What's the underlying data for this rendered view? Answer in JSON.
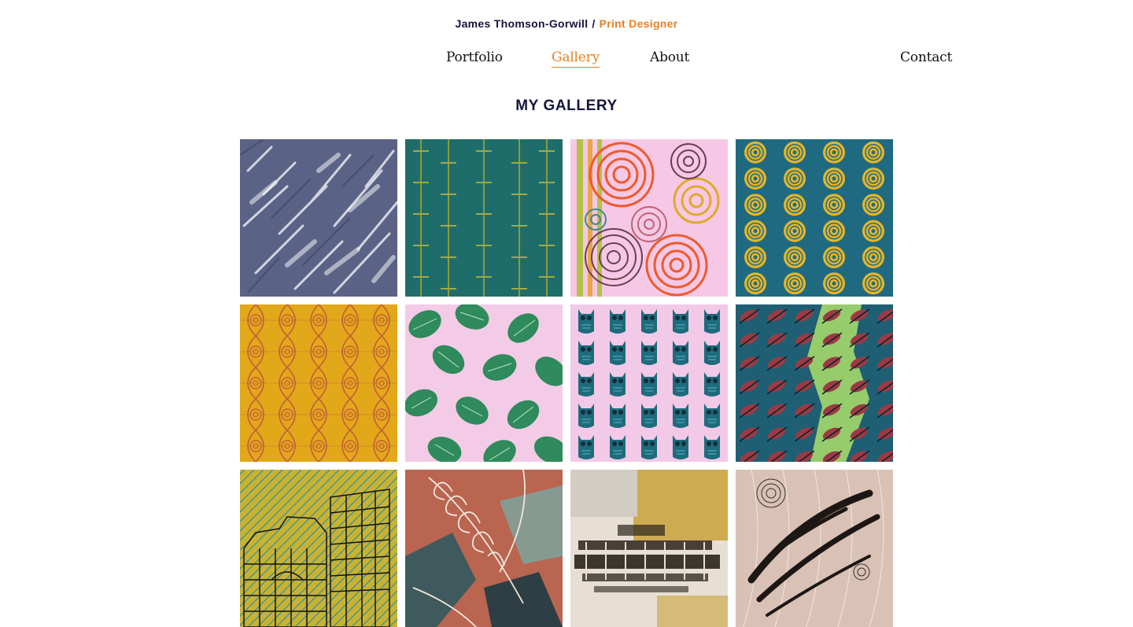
{
  "header": {
    "name": "James Thomson-Gorwill",
    "separator": "/",
    "role": "Print Designer"
  },
  "nav": {
    "portfolio": "Portfolio",
    "gallery": "Gallery",
    "about": "About",
    "contact": "Contact",
    "active": "gallery"
  },
  "page": {
    "title": "MY GALLERY"
  },
  "colors": {
    "navy": "#14143c",
    "accent_orange": "#e8801f"
  },
  "gallery": {
    "items": [
      {
        "name": "gallery-tile-grey-foliage",
        "icon": "grey-textured-foliage-print"
      },
      {
        "name": "gallery-tile-green-lattice",
        "icon": "teal-green-lattice-print"
      },
      {
        "name": "gallery-tile-pink-circles",
        "icon": "pink-concentric-circles-print"
      },
      {
        "name": "gallery-tile-teal-yellow-circles",
        "icon": "teal-yellow-circle-grid-print"
      },
      {
        "name": "gallery-tile-mustard-geometric",
        "icon": "mustard-ogee-print"
      },
      {
        "name": "gallery-tile-pink-monstera",
        "icon": "pink-monstera-leaf-print"
      },
      {
        "name": "gallery-tile-pink-owls",
        "icon": "pink-teal-owl-print"
      },
      {
        "name": "gallery-tile-teal-birds",
        "icon": "teal-bird-print"
      },
      {
        "name": "gallery-tile-yellow-building",
        "icon": "yellow-building-sketch-print"
      },
      {
        "name": "gallery-tile-terracotta-feathers",
        "icon": "terracotta-feather-print"
      },
      {
        "name": "gallery-tile-grunge-texture",
        "icon": "mustard-grunge-texture-print"
      },
      {
        "name": "gallery-tile-ink-brushstrokes",
        "icon": "ink-brushstroke-print"
      }
    ]
  }
}
